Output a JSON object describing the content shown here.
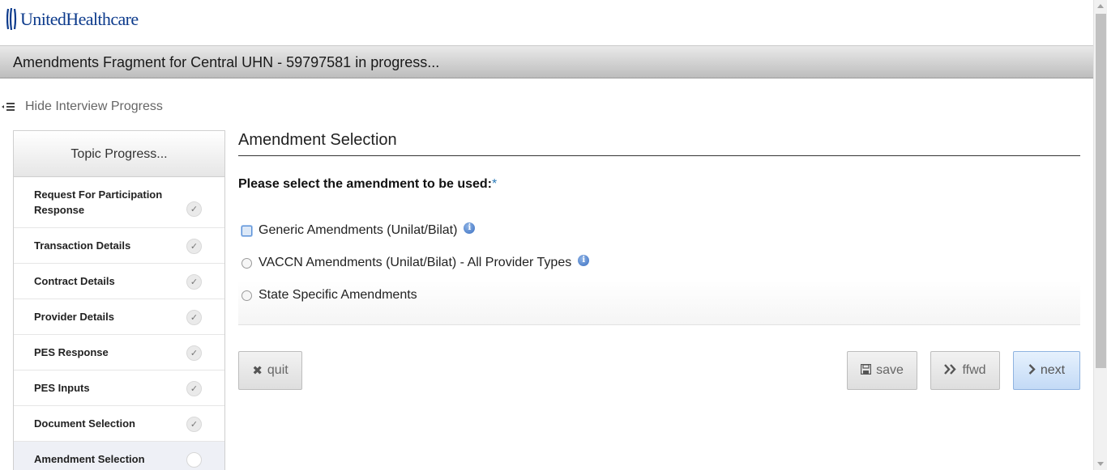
{
  "brand": {
    "name": "UnitedHealthcare"
  },
  "header": {
    "title": "Amendments Fragment for Central UHN - 59797581 in progress..."
  },
  "progress_toggle": {
    "label": "Hide Interview Progress",
    "icon": "list-collapse-icon"
  },
  "topic_panel": {
    "title": "Topic Progress...",
    "items": [
      {
        "label": "Request For Participation Response",
        "status": "complete"
      },
      {
        "label": "Transaction Details",
        "status": "complete"
      },
      {
        "label": "Contract Details",
        "status": "complete"
      },
      {
        "label": "Provider Details",
        "status": "complete"
      },
      {
        "label": "PES Response",
        "status": "complete"
      },
      {
        "label": "PES Inputs",
        "status": "complete"
      },
      {
        "label": "Document Selection",
        "status": "complete"
      },
      {
        "label": "Amendment Selection",
        "status": "current"
      }
    ]
  },
  "main": {
    "section_title": "Amendment Selection",
    "question": "Please select the amendment to be used:",
    "required_marker": "*",
    "options": [
      {
        "label": "Generic Amendments (Unilat/Bilat)",
        "has_info": true,
        "focused": true
      },
      {
        "label": "VACCN Amendments (Unilat/Bilat) - All Provider Types",
        "has_info": true,
        "focused": false
      },
      {
        "label": "State Specific Amendments",
        "has_info": false,
        "focused": false
      }
    ],
    "info_glyph": "i"
  },
  "buttons": {
    "quit": "quit",
    "save": "save",
    "ffwd": "ffwd",
    "next": "next"
  },
  "colors": {
    "brand_blue": "#0d3b8c",
    "required": "#2a7ab8",
    "next_bg": "#c3daf6"
  }
}
